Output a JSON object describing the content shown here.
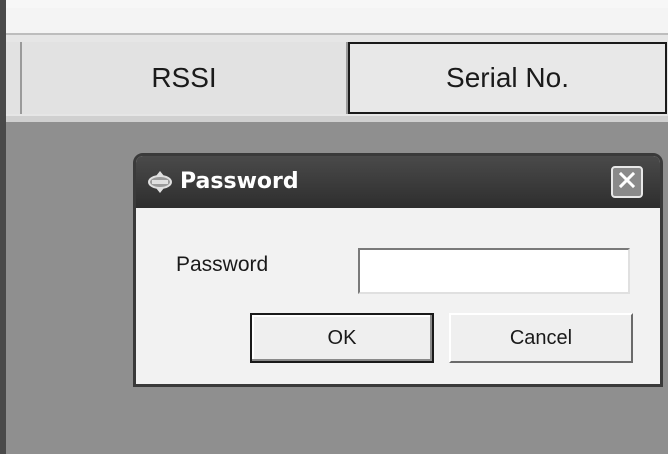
{
  "table_header": {
    "columns": [
      "",
      "RSSI",
      "Serial No."
    ]
  },
  "dialog": {
    "title": "Password",
    "field_label": "Password",
    "field_value": "",
    "ok_label": "OK",
    "cancel_label": "Cancel",
    "icons": {
      "title_icon": "key-icon",
      "close_icon": "close-icon"
    }
  },
  "colors": {
    "titlebar": "#333333",
    "workspace": "#8f8f8f",
    "header": "#e2e2e2"
  }
}
